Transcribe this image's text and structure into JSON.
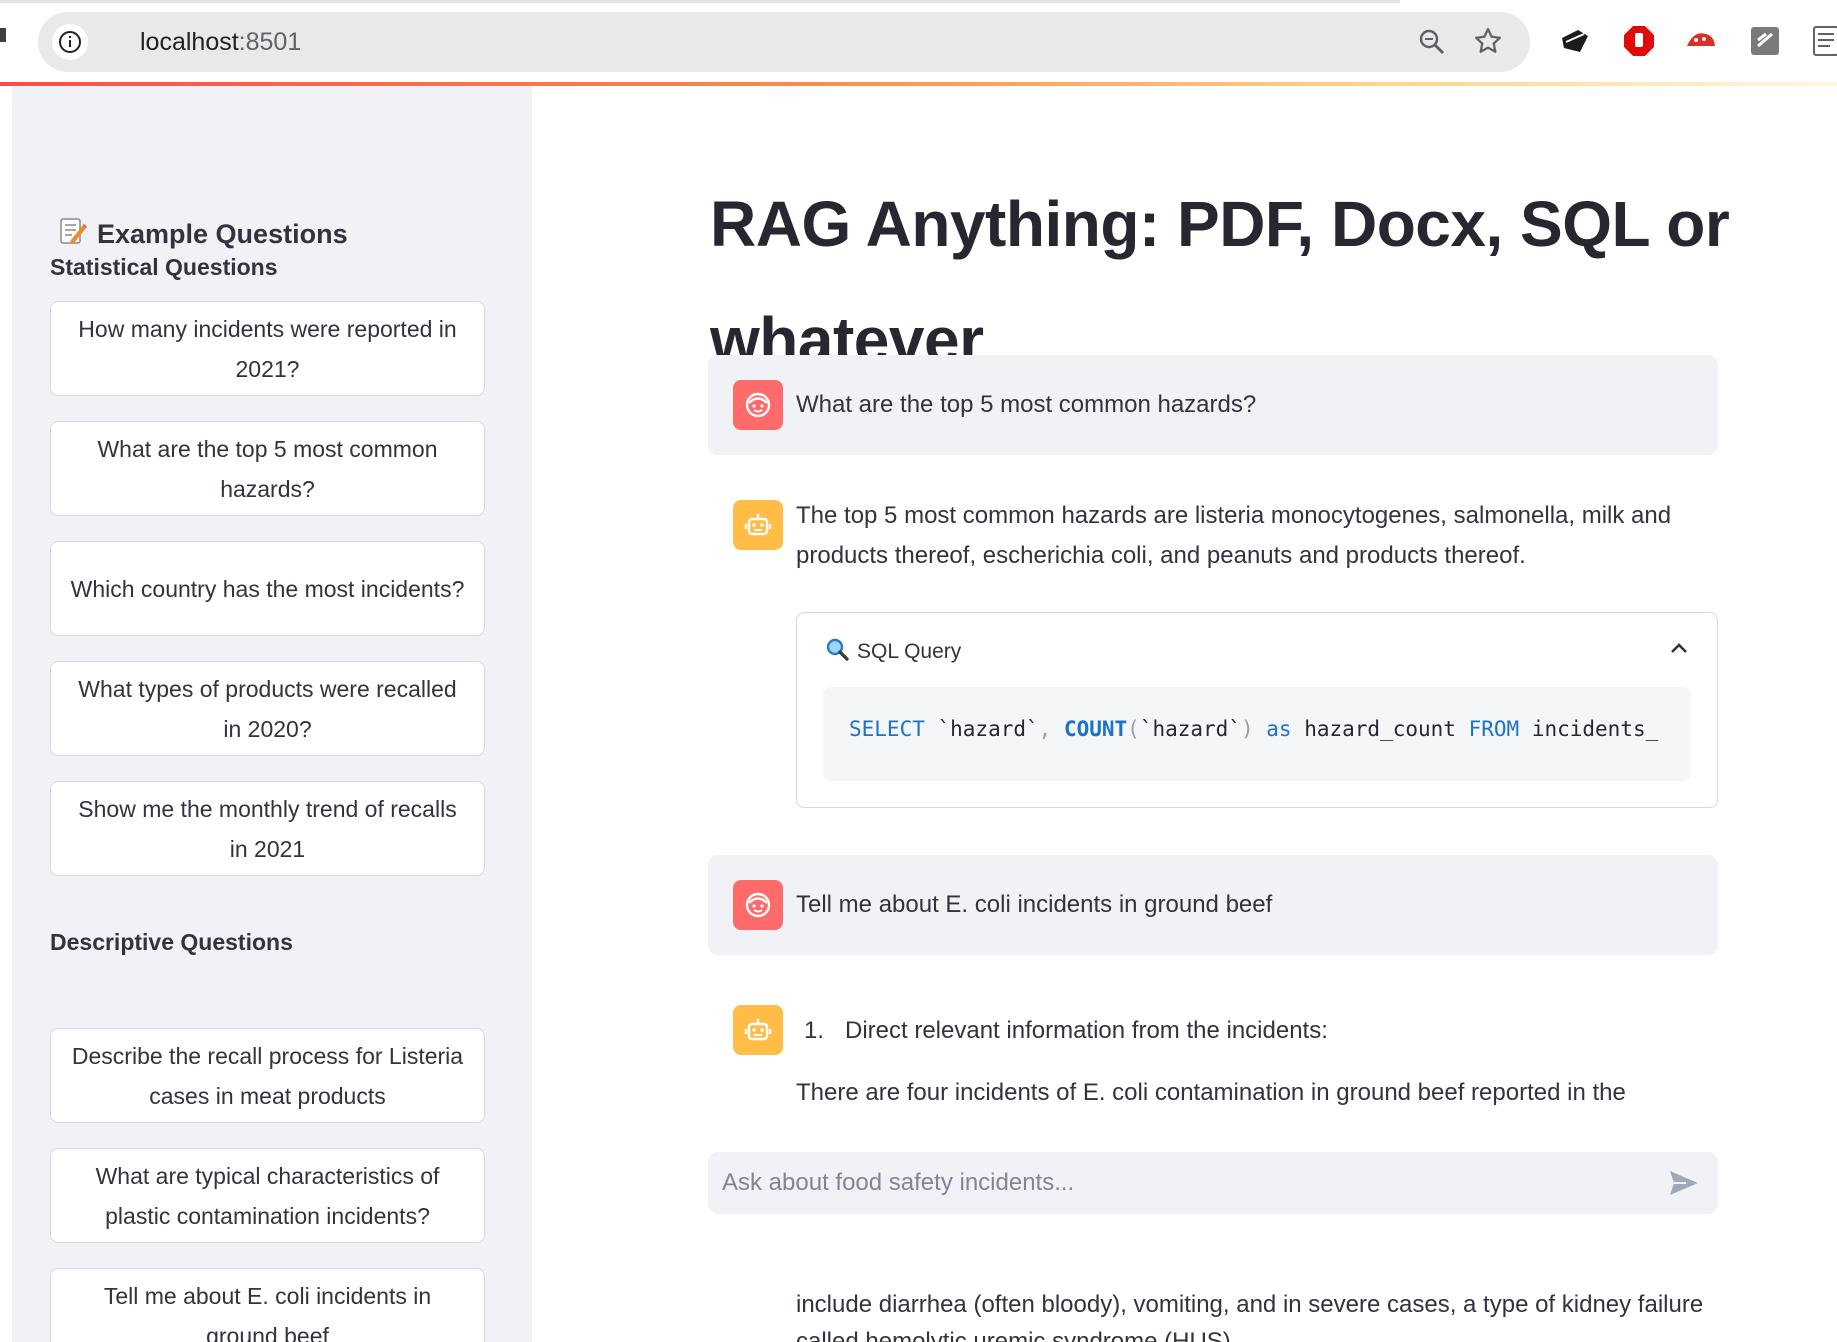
{
  "browser": {
    "url_host": "localhost",
    "url_port": ":8501"
  },
  "sidebar": {
    "title": "Example Questions",
    "sections": [
      {
        "heading": "Statistical Questions",
        "questions": [
          "How many incidents were reported in 2021?",
          "What are the top 5 most common hazards?",
          "Which country has the most incidents?",
          "What types of products were recalled in 2020?",
          "Show me the monthly trend of recalls in 2021"
        ]
      },
      {
        "heading": "Descriptive Questions",
        "questions": [
          "Describe the recall process for Listeria cases in meat products",
          "What are typical characteristics of plastic contamination incidents?",
          "Tell me about E. coli incidents in ground beef"
        ]
      }
    ]
  },
  "main": {
    "title": "RAG Anything: PDF, Docx, SQL or whatever",
    "messages": [
      {
        "role": "user",
        "text": "What are the top 5 most common hazards?"
      },
      {
        "role": "assistant",
        "text": "The top 5 most common hazards are listeria monocytogenes, salmonella, milk and products thereof, escherichia coli, and peanuts and products thereof."
      },
      {
        "role": "user",
        "text": "Tell me about E. coli incidents in ground beef"
      },
      {
        "role": "assistant",
        "list_number": "1.",
        "list_text": "Direct relevant information from the incidents:",
        "text": "There are four incidents of E. coli contamination in ground beef reported in the"
      }
    ],
    "sql_expander": {
      "label": "SQL Query",
      "code_tokens": {
        "select": "SELECT",
        "col1": " `hazard`",
        "comma": ",",
        "count": " COUNT",
        "paren_open": "(",
        "col2": "`hazard`",
        "paren_close": ")",
        "as": " as",
        "alias": " hazard_count",
        "from": " FROM",
        "table": " incidents_"
      }
    },
    "chat_input": {
      "placeholder": "Ask about food safety incidents..."
    },
    "underlying_text": [
      "include diarrhea (often bloody), vomiting, and in severe cases, a type of kidney failure",
      "called hemolytic uremic syndrome (HUS)."
    ]
  },
  "colors": {
    "user_avatar": "#ff6b6b",
    "assistant_avatar": "#ffbd45",
    "sidebar_bg": "#f0f2f6",
    "accent_sql": "#1a73c8"
  }
}
